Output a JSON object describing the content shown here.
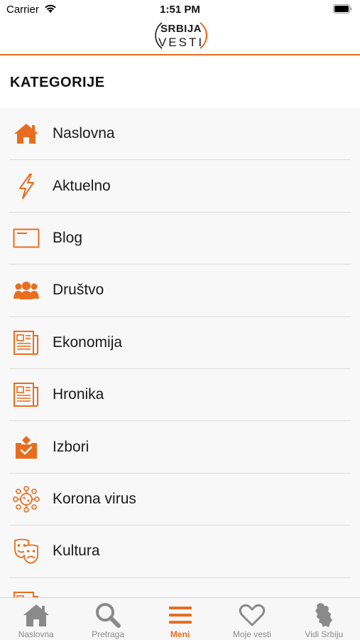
{
  "status_bar": {
    "carrier": "Carrier",
    "time": "1:51 PM"
  },
  "logo": {
    "line1": "SRBIJA",
    "line2": "VESTI"
  },
  "header": {
    "title": "KATEGORIJE"
  },
  "colors": {
    "accent": "#e86d1f",
    "tab_inactive": "#8a8a8a",
    "list_bg": "#f8f8f8"
  },
  "categories": [
    {
      "label": "Naslovna",
      "icon": "home-icon"
    },
    {
      "label": "Aktuelno",
      "icon": "lightning-icon"
    },
    {
      "label": "Blog",
      "icon": "blog-icon"
    },
    {
      "label": "Društvo",
      "icon": "people-icon"
    },
    {
      "label": "Ekonomija",
      "icon": "newspaper-icon"
    },
    {
      "label": "Hronika",
      "icon": "newspaper-icon"
    },
    {
      "label": "Izbori",
      "icon": "ballot-box-icon"
    },
    {
      "label": "Korona virus",
      "icon": "virus-icon"
    },
    {
      "label": "Kultura",
      "icon": "theater-masks-icon"
    }
  ],
  "tabs": [
    {
      "label": "Naslovna",
      "icon": "home-icon",
      "active": false
    },
    {
      "label": "Pretraga",
      "icon": "search-icon",
      "active": false
    },
    {
      "label": "Meni",
      "icon": "menu-icon",
      "active": true
    },
    {
      "label": "Moje vesti",
      "icon": "heart-icon",
      "active": false
    },
    {
      "label": "Vidi Srbiju",
      "icon": "map-icon",
      "active": false
    }
  ]
}
